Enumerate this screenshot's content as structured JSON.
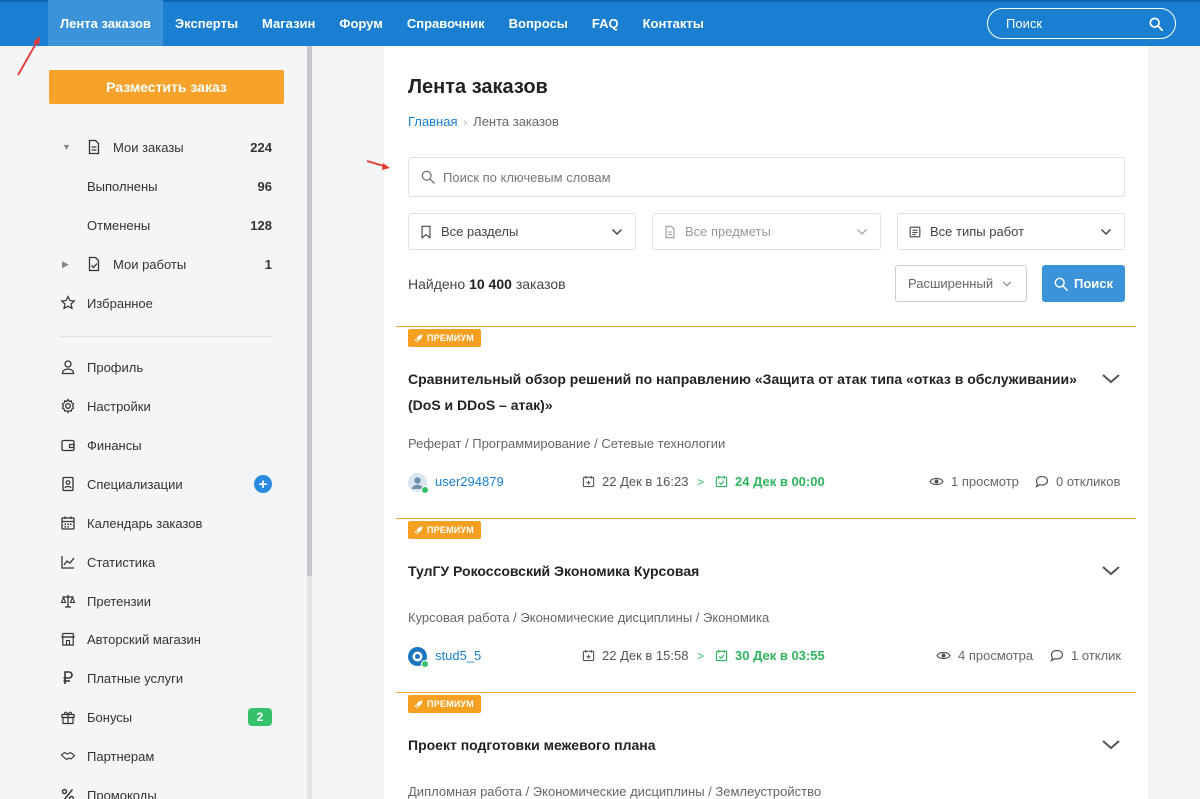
{
  "topnav": {
    "items": [
      {
        "label": "Лента заказов",
        "active": true
      },
      {
        "label": "Эксперты"
      },
      {
        "label": "Магазин"
      },
      {
        "label": "Форум"
      },
      {
        "label": "Справочник"
      },
      {
        "label": "Вопросы"
      },
      {
        "label": "FAQ"
      },
      {
        "label": "Контакты"
      }
    ],
    "search_placeholder": "Поиск",
    "color": "#1a7fd0"
  },
  "sidebar": {
    "order_button": "Разместить заказ",
    "my_orders": {
      "label": "Мои заказы",
      "count": "224",
      "icon": "document-icon"
    },
    "done": {
      "label": "Выполнены",
      "count": "96"
    },
    "cancelled": {
      "label": "Отменены",
      "count": "128"
    },
    "my_works": {
      "label": "Мои работы",
      "count": "1",
      "icon": "document-check-icon"
    },
    "favorites": {
      "label": "Избранное",
      "icon": "star-icon"
    },
    "menu": [
      {
        "label": "Профиль",
        "icon": "user-icon"
      },
      {
        "label": "Настройки",
        "icon": "gear-icon"
      },
      {
        "label": "Финансы",
        "icon": "wallet-icon"
      },
      {
        "label": "Специализации",
        "icon": "id-card-icon",
        "badge": "+"
      },
      {
        "label": "Календарь заказов",
        "icon": "calendar-icon"
      },
      {
        "label": "Статистика",
        "icon": "chart-icon"
      },
      {
        "label": "Претензии",
        "icon": "scales-icon"
      },
      {
        "label": "Авторский магазин",
        "icon": "shop-icon"
      },
      {
        "label": "Платные услуги",
        "icon": "ruble-icon"
      },
      {
        "label": "Бонусы",
        "icon": "gift-icon",
        "badge": "2"
      },
      {
        "label": "Партнерам",
        "icon": "handshake-icon"
      },
      {
        "label": "Промокоды",
        "icon": "percent-icon"
      }
    ]
  },
  "main": {
    "title": "Лента заказов",
    "breadcrumb": {
      "home": "Главная",
      "current": "Лента заказов"
    },
    "keyword_placeholder": "Поиск по ключевым словам",
    "filters": {
      "sections": "Все разделы",
      "subjects": "Все предметы",
      "work_types": "Все типы работ"
    },
    "found": {
      "prefix": "Найдено",
      "count": "10 400",
      "suffix": "заказов"
    },
    "advanced_label": "Расширенный",
    "search_button": "Поиск",
    "orders": [
      {
        "badge": "ПРЕМИУМ",
        "title": "Сравнительный обзор решений по направлению «Защита от атак типа «отказ в обслуживании» (DoS и DDoS – атак)»",
        "categories": "Реферат  /  Программирование  /  Сетевые технологии",
        "user": "user294879",
        "created": "22 Дек в 16:23",
        "deadline": "24 Дек в 00:00",
        "views": "1 просмотр",
        "responses": "0 откликов"
      },
      {
        "badge": "ПРЕМИУМ",
        "title": "ТулГУ Рокоссовский Экономика Курсовая",
        "categories": "Курсовая работа  /  Экономические дисциплины  /  Экономика",
        "user": "stud5_5",
        "created": "22 Дек в 15:58",
        "deadline": "30 Дек в 03:55",
        "views": "4 просмотра",
        "responses": "1 отклик"
      },
      {
        "badge": "ПРЕМИУМ",
        "title": "Проект подготовки межевого плана",
        "categories": "Дипломная работа  /  Экономические дисциплины  /  Землеустройство"
      }
    ]
  },
  "colors": {
    "accent": "#1a7fd0",
    "premium": "#f5a021",
    "deadline": "#2fb55f",
    "annotation": "#e53935"
  }
}
